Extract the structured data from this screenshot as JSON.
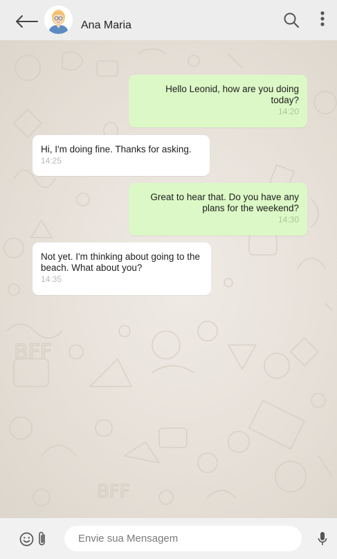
{
  "header": {
    "contact_name": "Ana Maria",
    "icons": {
      "back": "back-arrow-icon",
      "search": "search-icon",
      "menu": "more-vertical-icon"
    }
  },
  "messages": [
    {
      "direction": "out",
      "text": "Hello Leonid, how are you doing today?",
      "time": "14:20"
    },
    {
      "direction": "in",
      "text": "Hi, I'm doing fine. Thanks for asking.",
      "time": "14:25"
    },
    {
      "direction": "out",
      "text": "Great to hear that. Do you have any plans for the weekend?",
      "time": "14:30"
    },
    {
      "direction": "in",
      "text": "Not yet. I'm thinking about going to the beach. What about you?",
      "time": "14:35"
    }
  ],
  "composer": {
    "placeholder": "Envie sua Mensagem",
    "value": "",
    "icons": {
      "emoji": "emoji-icon",
      "attach": "paperclip-icon",
      "mic": "microphone-icon"
    }
  },
  "colors": {
    "outgoing_bubble": "#dcf8c6",
    "incoming_bubble": "#ffffff",
    "header_bg": "#ededed",
    "chat_bg": "#e9e4dc"
  }
}
